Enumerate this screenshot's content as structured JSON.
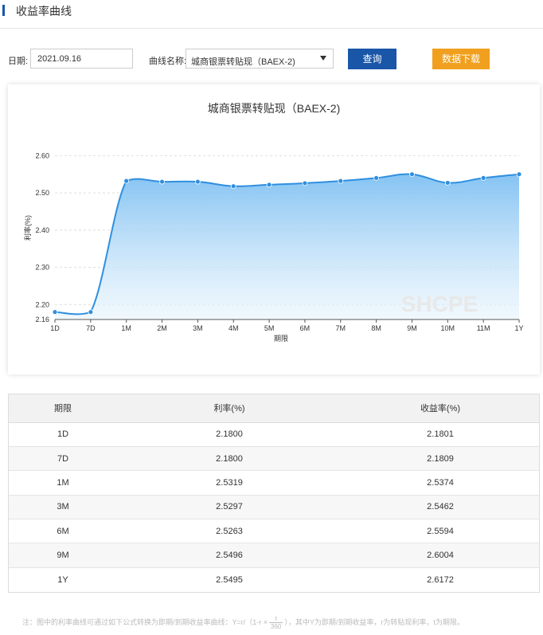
{
  "header": {
    "title": "收益率曲线"
  },
  "filters": {
    "date_label": "日期:",
    "date_value": "2021.09.16",
    "curve_label": "曲线名称:",
    "curve_value": "城商银票转贴现（BAEX-2)",
    "query_button": "查询",
    "download_button": "数据下载"
  },
  "colors": {
    "accent": "#1a56a8",
    "download": "#f0a01e",
    "series": "#2f8fe0"
  },
  "chart_data": {
    "type": "area",
    "title": "城商银票转贴现（BAEX-2)",
    "xlabel": "期限",
    "ylabel": "利率(%)",
    "categories": [
      "1D",
      "7D",
      "1M",
      "2M",
      "3M",
      "4M",
      "5M",
      "6M",
      "7M",
      "8M",
      "9M",
      "10M",
      "11M",
      "1Y"
    ],
    "series": [
      {
        "values": [
          2.18,
          2.18,
          2.532,
          2.53,
          2.53,
          2.518,
          2.522,
          2.526,
          2.532,
          2.54,
          2.55,
          2.527,
          2.54,
          2.55
        ]
      }
    ],
    "ylim": [
      2.16,
      2.62
    ],
    "yticks": [
      "2.60",
      "2.50",
      "2.40",
      "2.30",
      "2.20",
      "2.16"
    ],
    "grid": true,
    "watermark": "SHCPE"
  },
  "table": {
    "headers": [
      "期限",
      "利率(%)",
      "收益率(%)"
    ],
    "rows": [
      [
        "1D",
        "2.1800",
        "2.1801"
      ],
      [
        "7D",
        "2.1800",
        "2.1809"
      ],
      [
        "1M",
        "2.5319",
        "2.5374"
      ],
      [
        "3M",
        "2.5297",
        "2.5462"
      ],
      [
        "6M",
        "2.5263",
        "2.5594"
      ],
      [
        "9M",
        "2.5496",
        "2.6004"
      ],
      [
        "1Y",
        "2.5495",
        "2.6172"
      ]
    ]
  },
  "note": {
    "prefix": "注：图中的利率曲线可通过如下公式转换为即期/到期收益率曲线：Y=r/（1-r ×",
    "numerator": "t",
    "denominator": "360",
    "suffix": "），其中Y为即期/到期收益率，r为转贴现利率，t为期限。"
  }
}
